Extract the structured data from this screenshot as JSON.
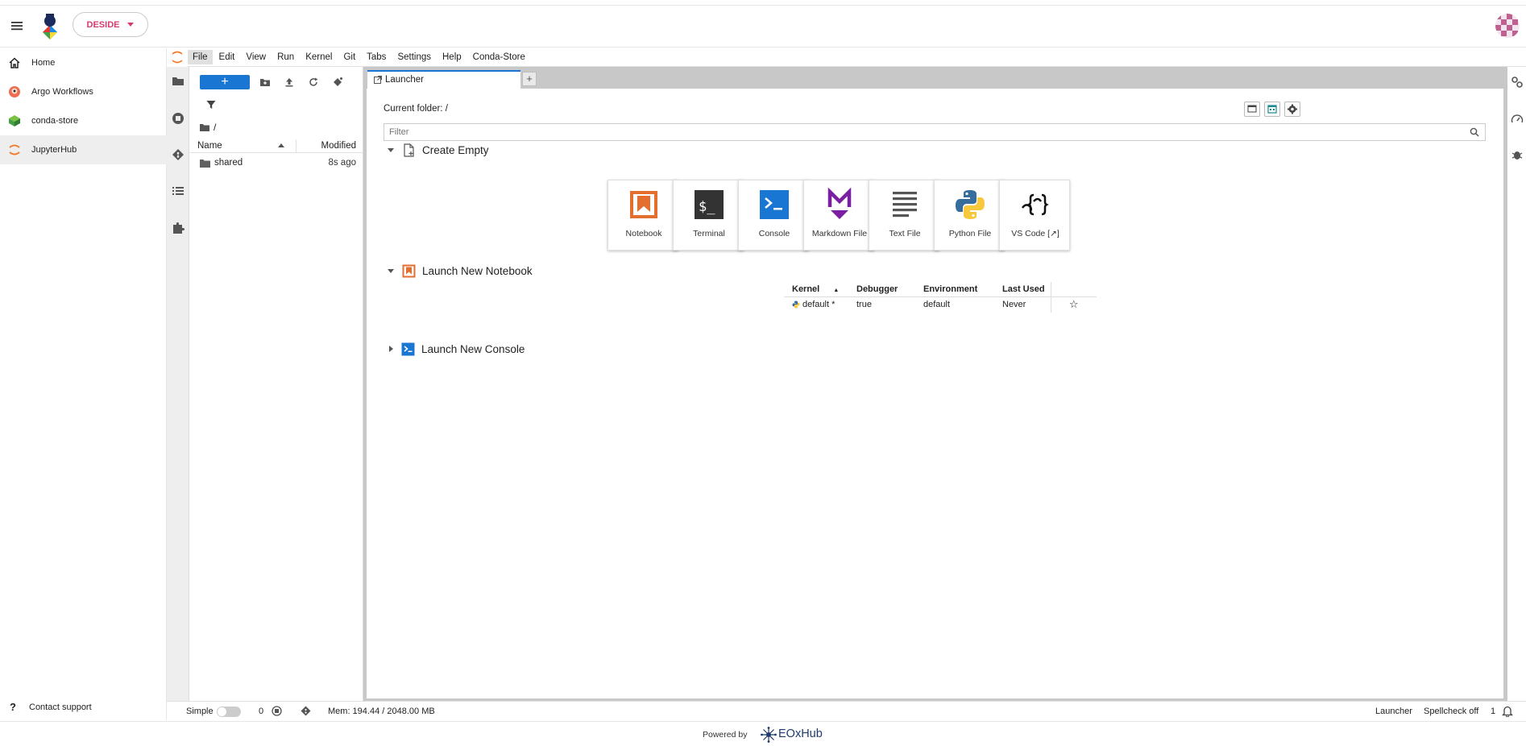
{
  "topbar": {
    "tenant": "DESIDE"
  },
  "hub_sidebar": {
    "items": [
      {
        "label": "Home",
        "icon": "home-icon"
      },
      {
        "label": "Argo Workflows",
        "icon": "argo-icon"
      },
      {
        "label": "conda-store",
        "icon": "conda-store-icon"
      },
      {
        "label": "JupyterHub",
        "icon": "jupyter-icon",
        "active": true
      }
    ],
    "contact_support": "Contact support"
  },
  "menubar": [
    "File",
    "Edit",
    "View",
    "Run",
    "Kernel",
    "Git",
    "Tabs",
    "Settings",
    "Help",
    "Conda-Store"
  ],
  "file_browser": {
    "new_label": "+",
    "breadcrumb": "/",
    "columns": {
      "name": "Name",
      "modified": "Modified"
    },
    "rows": [
      {
        "name": "shared",
        "modified": "8s ago",
        "type": "folder"
      }
    ]
  },
  "tabs": {
    "launcher": "Launcher",
    "add": "+"
  },
  "launcher": {
    "current_folder": "Current folder: /",
    "filter_placeholder": "Filter",
    "sections": {
      "create_empty": "Create Empty",
      "new_notebook": "Launch New Notebook",
      "new_console": "Launch New Console"
    },
    "cards": [
      {
        "label": "Notebook",
        "icon": "notebook-icon"
      },
      {
        "label": "Terminal",
        "icon": "terminal-icon"
      },
      {
        "label": "Console",
        "icon": "console-icon"
      },
      {
        "label": "Markdown File",
        "icon": "markdown-icon"
      },
      {
        "label": "Text File",
        "icon": "text-file-icon"
      },
      {
        "label": "Python File",
        "icon": "python-icon"
      },
      {
        "label": "VS Code [↗]",
        "icon": "vscode-icon"
      }
    ],
    "kernel_table": {
      "headers": [
        "Kernel",
        "Debugger",
        "Environment",
        "Last Used"
      ],
      "rows": [
        {
          "kernel": "default *",
          "debugger": "true",
          "environment": "default",
          "last_used": "Never"
        }
      ]
    }
  },
  "statusbar": {
    "simple": "Simple",
    "count": "0",
    "mem": "Mem: 194.44 / 2048.00 MB",
    "launcher": "Launcher",
    "spellcheck": "Spellcheck off",
    "notifications": "1"
  },
  "footer": {
    "powered_by": "Powered by",
    "brand": "EOxHub"
  },
  "colors": {
    "accent": "#1976d2",
    "tenant": "#d63a6e",
    "notebook": "#e46e2e",
    "markdown": "#7b1fa2"
  }
}
